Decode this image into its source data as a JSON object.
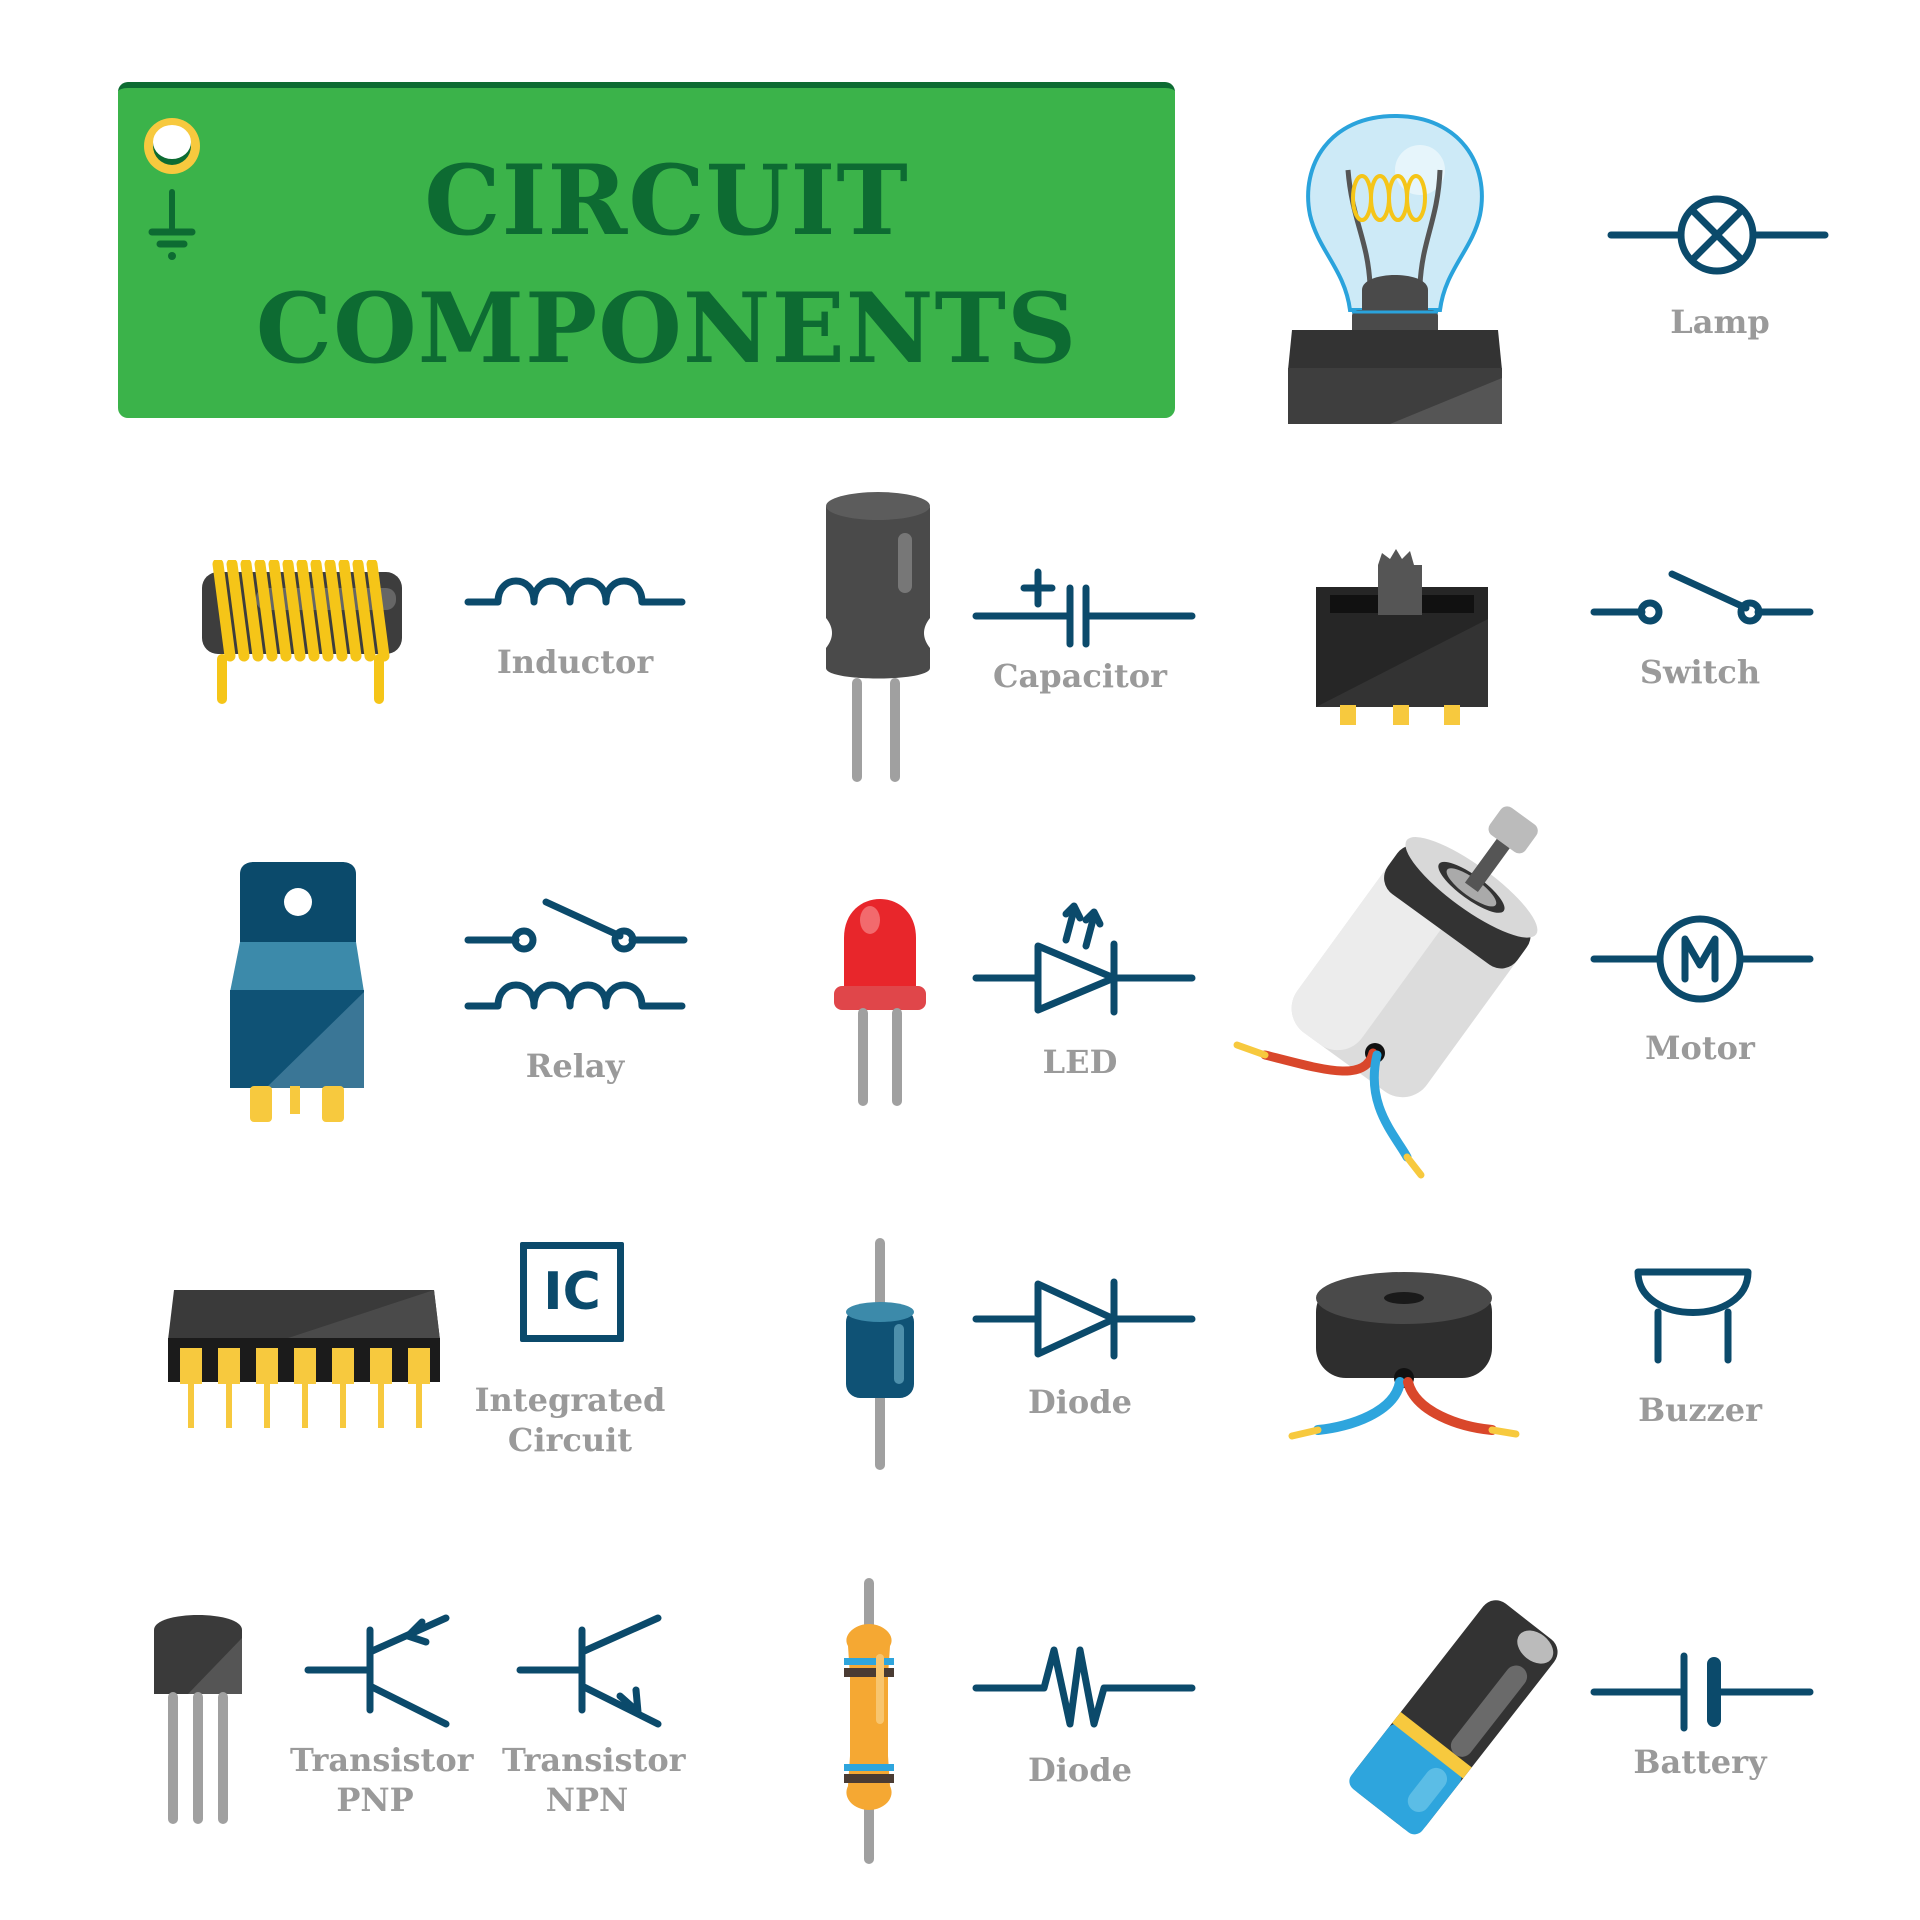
{
  "header": {
    "title_line1": "CIRCUIT",
    "title_line2": "COMPONENTS",
    "icon": "ground-probe-icon"
  },
  "colors": {
    "banner_green": "#3bb34a",
    "title_dark_green": "#0d6b32",
    "symbol_blue": "#0b4a6b",
    "label_gray": "#9a9a9a",
    "gold": "#f5c518",
    "red": "#e8262b",
    "wire_red": "#d9472b",
    "wire_blue": "#2ea5dd"
  },
  "components": [
    {
      "id": "lamp",
      "label": "Lamp",
      "symbol": "lamp-symbol-icon",
      "illustration": "light-bulb-icon"
    },
    {
      "id": "inductor",
      "label": "Inductor",
      "symbol": "inductor-symbol-icon",
      "illustration": "coil-icon"
    },
    {
      "id": "capacitor",
      "label": "Capacitor",
      "symbol": "capacitor-symbol-icon",
      "illustration": "electrolytic-capacitor-icon"
    },
    {
      "id": "switch",
      "label": "Switch",
      "symbol": "switch-symbol-icon",
      "illustration": "slide-switch-icon"
    },
    {
      "id": "relay",
      "label": "Relay",
      "symbol": "relay-symbol-icon",
      "illustration": "relay-icon"
    },
    {
      "id": "led",
      "label": "LED",
      "symbol": "led-symbol-icon",
      "illustration": "red-led-icon"
    },
    {
      "id": "motor",
      "label": "Motor",
      "symbol": "motor-symbol-icon",
      "illustration": "dc-motor-icon",
      "symbol_letter": "M"
    },
    {
      "id": "ic",
      "label_line1": "Integrated",
      "label_line2": "Circuit",
      "symbol": "ic-symbol-icon",
      "illustration": "dip-chip-icon",
      "symbol_text": "IC"
    },
    {
      "id": "diode",
      "label": "Diode",
      "symbol": "diode-symbol-icon",
      "illustration": "diode-icon"
    },
    {
      "id": "buzzer",
      "label": "Buzzer",
      "symbol": "buzzer-symbol-icon",
      "illustration": "piezo-buzzer-icon"
    },
    {
      "id": "transistor_pnp",
      "label_line1": "Transistor",
      "label_line2": "PNP",
      "symbol": "pnp-symbol-icon",
      "illustration": "to92-transistor-icon"
    },
    {
      "id": "transistor_npn",
      "label_line1": "Transistor",
      "label_line2": "NPN",
      "symbol": "npn-symbol-icon"
    },
    {
      "id": "resistor",
      "label": "Diode",
      "symbol": "resistor-symbol-icon",
      "illustration": "resistor-icon"
    },
    {
      "id": "battery",
      "label": "Battery",
      "symbol": "battery-symbol-icon",
      "illustration": "battery-cell-icon"
    }
  ]
}
